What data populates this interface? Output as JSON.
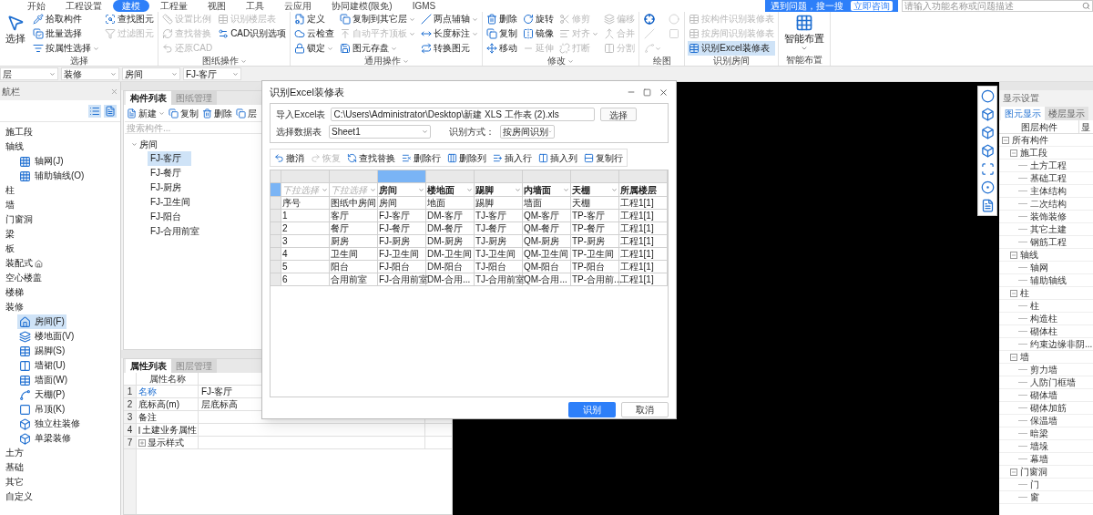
{
  "menu_tabs": [
    {
      "label": "开始",
      "selected": false
    },
    {
      "label": "工程设置",
      "selected": false
    },
    {
      "label": "建模",
      "selected": true
    },
    {
      "label": "工程量",
      "selected": false
    },
    {
      "label": "视图",
      "selected": false
    },
    {
      "label": "工具",
      "selected": false
    },
    {
      "label": "云应用",
      "selected": false
    },
    {
      "label": "协同建模(限免)",
      "selected": false
    },
    {
      "label": "IGMS",
      "selected": false
    }
  ],
  "help_banner": {
    "text": "遇到问题，搜一搜",
    "button": "立即咨询"
  },
  "search": {
    "placeholder": "请输入功能名称或问题描述"
  },
  "ribbon": [
    {
      "label": "选择",
      "dropdown": false,
      "columns": [
        [
          {
            "label": "选择",
            "kind": "large",
            "disabled": false,
            "selected": false,
            "dropdown": false
          }
        ],
        [
          {
            "label": "拾取构件",
            "kind": "small",
            "disabled": false,
            "selected": false,
            "dropdown": false
          },
          {
            "label": "批量选择",
            "kind": "small",
            "disabled": false,
            "selected": false,
            "dropdown": false
          },
          {
            "label": "按属性选择",
            "kind": "small",
            "disabled": false,
            "selected": false,
            "dropdown": true
          }
        ],
        [
          {
            "label": "查找图元",
            "kind": "small",
            "disabled": false,
            "selected": false,
            "dropdown": false
          },
          {
            "label": "过滤图元",
            "kind": "small",
            "disabled": true,
            "selected": false,
            "dropdown": false
          }
        ]
      ]
    },
    {
      "label": "图纸操作",
      "dropdown": true,
      "columns": [
        [
          {
            "label": "设置比例",
            "kind": "small",
            "disabled": true,
            "selected": false,
            "dropdown": false
          },
          {
            "label": "查找替换",
            "kind": "small",
            "disabled": true,
            "selected": false,
            "dropdown": false
          },
          {
            "label": "还原CAD",
            "kind": "small",
            "disabled": true,
            "selected": false,
            "dropdown": false
          }
        ],
        [
          {
            "label": "识别楼层表",
            "kind": "small",
            "disabled": true,
            "selected": false,
            "dropdown": false
          },
          {
            "label": "CAD识别选项",
            "kind": "small",
            "disabled": false,
            "selected": false,
            "dropdown": false
          }
        ]
      ]
    },
    {
      "label": "通用操作",
      "dropdown": true,
      "columns": [
        [
          {
            "label": "定义",
            "kind": "small",
            "disabled": false,
            "selected": false,
            "dropdown": false
          },
          {
            "label": "云检查",
            "kind": "small",
            "disabled": false,
            "selected": false,
            "dropdown": false
          },
          {
            "label": "锁定",
            "kind": "small",
            "disabled": false,
            "selected": false,
            "dropdown": true
          }
        ],
        [
          {
            "label": "复制到其它层",
            "kind": "small",
            "disabled": false,
            "selected": false,
            "dropdown": true
          },
          {
            "label": "自动平齐顶板",
            "kind": "small",
            "disabled": true,
            "selected": false,
            "dropdown": true
          },
          {
            "label": "图元存盘",
            "kind": "small",
            "disabled": false,
            "selected": false,
            "dropdown": true
          }
        ],
        [
          {
            "label": "两点辅轴",
            "kind": "small",
            "disabled": false,
            "selected": false,
            "dropdown": true
          },
          {
            "label": "长度标注",
            "kind": "small",
            "disabled": false,
            "selected": false,
            "dropdown": true
          },
          {
            "label": "转换图元",
            "kind": "small",
            "disabled": false,
            "selected": false,
            "dropdown": false
          }
        ]
      ]
    },
    {
      "label": "修改",
      "dropdown": true,
      "columns": [
        [
          {
            "label": "删除",
            "kind": "small",
            "disabled": false,
            "selected": false,
            "dropdown": false
          },
          {
            "label": "复制",
            "kind": "small",
            "disabled": false,
            "selected": false,
            "dropdown": false
          },
          {
            "label": "移动",
            "kind": "small",
            "disabled": false,
            "selected": false,
            "dropdown": false
          }
        ],
        [
          {
            "label": "旋转",
            "kind": "small",
            "disabled": false,
            "selected": false,
            "dropdown": false
          },
          {
            "label": "镜像",
            "kind": "small",
            "disabled": false,
            "selected": false,
            "dropdown": false
          },
          {
            "label": "延伸",
            "kind": "small",
            "disabled": true,
            "selected": false,
            "dropdown": false
          }
        ],
        [
          {
            "label": "修剪",
            "kind": "small",
            "disabled": true,
            "selected": false,
            "dropdown": false
          },
          {
            "label": "对齐",
            "kind": "small",
            "disabled": true,
            "selected": false,
            "dropdown": true
          },
          {
            "label": "打断",
            "kind": "small",
            "disabled": true,
            "selected": false,
            "dropdown": false
          }
        ],
        [
          {
            "label": "偏移",
            "kind": "small",
            "disabled": true,
            "selected": false,
            "dropdown": false
          },
          {
            "label": "合并",
            "kind": "small",
            "disabled": true,
            "selected": false,
            "dropdown": false
          },
          {
            "label": "分割",
            "kind": "small",
            "disabled": true,
            "selected": false,
            "dropdown": false
          }
        ]
      ]
    },
    {
      "label": "绘图",
      "dropdown": false,
      "columns": [
        [
          {
            "kind": "icon",
            "disabled": false,
            "selected": false,
            "dropdown": false
          },
          {
            "kind": "icon",
            "disabled": true,
            "selected": false,
            "dropdown": false
          },
          {
            "kind": "icon",
            "disabled": true,
            "selected": false,
            "dropdown": true
          }
        ],
        [
          {
            "kind": "icon",
            "disabled": true,
            "selected": false,
            "dropdown": false
          },
          {
            "kind": "icon",
            "disabled": true,
            "selected": false,
            "dropdown": false
          }
        ]
      ]
    },
    {
      "label": "识别房间",
      "dropdown": false,
      "columns": [
        [
          {
            "label": "按构件识别装修表",
            "kind": "small",
            "disabled": true,
            "selected": false,
            "dropdown": false
          },
          {
            "label": "按房间识别装修表",
            "kind": "small",
            "disabled": true,
            "selected": false,
            "dropdown": false
          },
          {
            "label": "识别Excel装修表",
            "kind": "small",
            "disabled": false,
            "selected": true,
            "dropdown": false
          }
        ]
      ]
    },
    {
      "label": "智能布置",
      "dropdown": false,
      "columns": [
        [
          {
            "label": "智能布置",
            "kind": "large",
            "disabled": false,
            "selected": false,
            "dropdown": true
          }
        ]
      ]
    }
  ],
  "selectors": [
    "层",
    "装修",
    "房间",
    "FJ-客厅"
  ],
  "nav": {
    "title": "航栏",
    "items": [
      {
        "label": "施工段",
        "selected": false
      },
      {
        "label": "轴线",
        "selected": false,
        "children": [
          {
            "label": "轴网(J)",
            "selected": false
          },
          {
            "label": "辅助轴线(O)",
            "selected": false
          }
        ]
      },
      {
        "label": "柱",
        "selected": false
      },
      {
        "label": "墙",
        "selected": false
      },
      {
        "label": "门窗洞",
        "selected": false
      },
      {
        "label": "梁",
        "selected": false
      },
      {
        "label": "板",
        "selected": false
      },
      {
        "label": "装配式",
        "selected": false,
        "suffix_icon": true
      },
      {
        "label": "空心楼盖",
        "selected": false
      },
      {
        "label": "楼梯",
        "selected": false
      },
      {
        "label": "装修",
        "selected": false,
        "children": [
          {
            "label": "房间(F)",
            "selected": true
          },
          {
            "label": "楼地面(V)",
            "selected": false
          },
          {
            "label": "踢脚(S)",
            "selected": false
          },
          {
            "label": "墙裙(U)",
            "selected": false
          },
          {
            "label": "墙面(W)",
            "selected": false
          },
          {
            "label": "天棚(P)",
            "selected": false
          },
          {
            "label": "吊顶(K)",
            "selected": false
          },
          {
            "label": "独立柱装修",
            "selected": false
          },
          {
            "label": "单梁装修",
            "selected": false
          }
        ]
      },
      {
        "label": "土方",
        "selected": false
      },
      {
        "label": "基础",
        "selected": false
      },
      {
        "label": "其它",
        "selected": false
      },
      {
        "label": "自定义",
        "selected": false
      }
    ]
  },
  "component_panel": {
    "tabs": [
      {
        "label": "构件列表",
        "selected": true
      },
      {
        "label": "图纸管理",
        "selected": false
      }
    ],
    "toolbar": [
      {
        "label": "新建",
        "dropdown": true
      },
      {
        "label": "复制",
        "dropdown": false
      },
      {
        "label": "删除",
        "dropdown": false
      },
      {
        "label": "层",
        "dropdown": false
      }
    ],
    "search": {
      "placeholder": "搜索构件..."
    },
    "tree": {
      "label": "房间",
      "expanded": true,
      "children": [
        {
          "label": "FJ-客厅",
          "selected": true
        },
        {
          "label": "FJ-餐厅",
          "selected": false
        },
        {
          "label": "FJ-厨房",
          "selected": false
        },
        {
          "label": "FJ-卫生间",
          "selected": false
        },
        {
          "label": "FJ-阳台",
          "selected": false
        },
        {
          "label": "FJ-合用前室",
          "selected": false
        }
      ]
    }
  },
  "properties_panel": {
    "tabs": [
      {
        "label": "属性列表",
        "selected": true
      },
      {
        "label": "图层管理",
        "selected": false
      }
    ],
    "header": "属性名称",
    "rows": [
      {
        "num": "1",
        "name": "名称",
        "value": "FJ-客厅",
        "emphasis": true,
        "kind": "plain"
      },
      {
        "num": "2",
        "name": "底标高(m)",
        "value": "层底标高",
        "emphasis": false,
        "kind": "plain"
      },
      {
        "num": "3",
        "name": "备注",
        "emphasis": false,
        "kind": "plain"
      },
      {
        "num": "4",
        "name": "土建业务属性",
        "emphasis": false,
        "kind": "group"
      },
      {
        "num": "7",
        "name": "显示样式",
        "emphasis": false,
        "kind": "group"
      }
    ]
  },
  "display_settings": {
    "title": "显示设置",
    "tabs": [
      {
        "label": "图元显示",
        "selected": true
      },
      {
        "label": "楼层显示",
        "selected": false
      }
    ],
    "columns": [
      "图层构件",
      "显"
    ],
    "tree": {
      "label": "所有构件",
      "expanded": true,
      "children": [
        {
          "label": "施工段",
          "expanded": true,
          "children": [
            {
              "label": "土方工程"
            },
            {
              "label": "基础工程"
            },
            {
              "label": "主体结构"
            },
            {
              "label": "二次结构"
            },
            {
              "label": "装饰装修"
            },
            {
              "label": "其它土建"
            },
            {
              "label": "钢筋工程"
            }
          ]
        },
        {
          "label": "轴线",
          "expanded": true,
          "children": [
            {
              "label": "轴网"
            },
            {
              "label": "辅助轴线"
            }
          ]
        },
        {
          "label": "柱",
          "expanded": true,
          "children": [
            {
              "label": "柱"
            },
            {
              "label": "构造柱"
            },
            {
              "label": "砌体柱"
            },
            {
              "label": "约束边缘非阴..."
            }
          ]
        },
        {
          "label": "墙",
          "expanded": true,
          "children": [
            {
              "label": "剪力墙"
            },
            {
              "label": "人防门框墙"
            },
            {
              "label": "砌体墙"
            },
            {
              "label": "砌体加筋"
            },
            {
              "label": "保温墙"
            },
            {
              "label": "暗梁"
            },
            {
              "label": "墙垛"
            },
            {
              "label": "幕墙"
            }
          ]
        },
        {
          "label": "门窗洞",
          "expanded": true,
          "children": [
            {
              "label": "门"
            },
            {
              "label": "窗"
            }
          ]
        }
      ]
    }
  },
  "dialog": {
    "title": "识别Excel装修表",
    "import_label": "导入Excel表",
    "path": "C:\\Users\\Administrator\\Desktop\\新建 XLS 工作表 (2).xls",
    "choose_button": "选择",
    "sheet_label": "选择数据表",
    "sheet": "Sheet1",
    "mode_label": "识别方式：",
    "mode": "按房间识别",
    "toolbar": [
      {
        "label": "撤消",
        "disabled": false
      },
      {
        "label": "恢复",
        "disabled": true
      },
      {
        "label": "查找替换",
        "disabled": false
      },
      {
        "label": "删除行",
        "disabled": false
      },
      {
        "label": "删除列",
        "disabled": false
      },
      {
        "label": "插入行",
        "disabled": false
      },
      {
        "label": "插入列",
        "disabled": false
      },
      {
        "label": "复制行",
        "disabled": false
      }
    ],
    "header_row_selected": true,
    "columns": [
      {
        "selected": false,
        "placeholder": "下拉选择",
        "dropdown": true
      },
      {
        "selected": false,
        "placeholder": "下拉选择",
        "dropdown": true
      },
      {
        "selected": true,
        "value": "房间",
        "dropdown": true
      },
      {
        "selected": false,
        "value": "楼地面",
        "dropdown": true
      },
      {
        "selected": false,
        "value": "踢脚",
        "dropdown": true
      },
      {
        "selected": false,
        "value": "内墙面",
        "dropdown": true
      },
      {
        "selected": false,
        "value": "天棚",
        "dropdown": true
      },
      {
        "selected": false,
        "value": "所属楼层",
        "dropdown": false
      }
    ],
    "rows": [
      [
        "序号",
        "图纸中房间",
        "房间",
        "地面",
        "踢脚",
        "墙面",
        "天棚",
        "工程1[1]"
      ],
      [
        "1",
        "客厅",
        "FJ-客厅",
        "DM-客厅",
        "TJ-客厅",
        "QM-客厅",
        "TP-客厅",
        "工程1[1]"
      ],
      [
        "2",
        "餐厅",
        "FJ-餐厅",
        "DM-餐厅",
        "TJ-餐厅",
        "QM-餐厅",
        "TP-餐厅",
        "工程1[1]"
      ],
      [
        "3",
        "厨房",
        "FJ-厨房",
        "DM-厨房",
        "TJ-厨房",
        "QM-厨房",
        "TP-厨房",
        "工程1[1]"
      ],
      [
        "4",
        "卫生间",
        "FJ-卫生间",
        "DM-卫生间",
        "TJ-卫生间",
        "QM-卫生间",
        "TP-卫生间",
        "工程1[1]"
      ],
      [
        "5",
        "阳台",
        "FJ-阳台",
        "DM-阳台",
        "TJ-阳台",
        "QM-阳台",
        "TP-阳台",
        "工程1[1]"
      ],
      [
        "6",
        "合用前室",
        "FJ-合用前室",
        "DM-合用...",
        "TJ-合用前室",
        "QM-合用...",
        "TP-合用前...",
        "工程1[1]"
      ]
    ],
    "buttons": [
      {
        "label": "识别",
        "kind": "primary"
      },
      {
        "label": "取消",
        "kind": "secondary"
      }
    ]
  }
}
